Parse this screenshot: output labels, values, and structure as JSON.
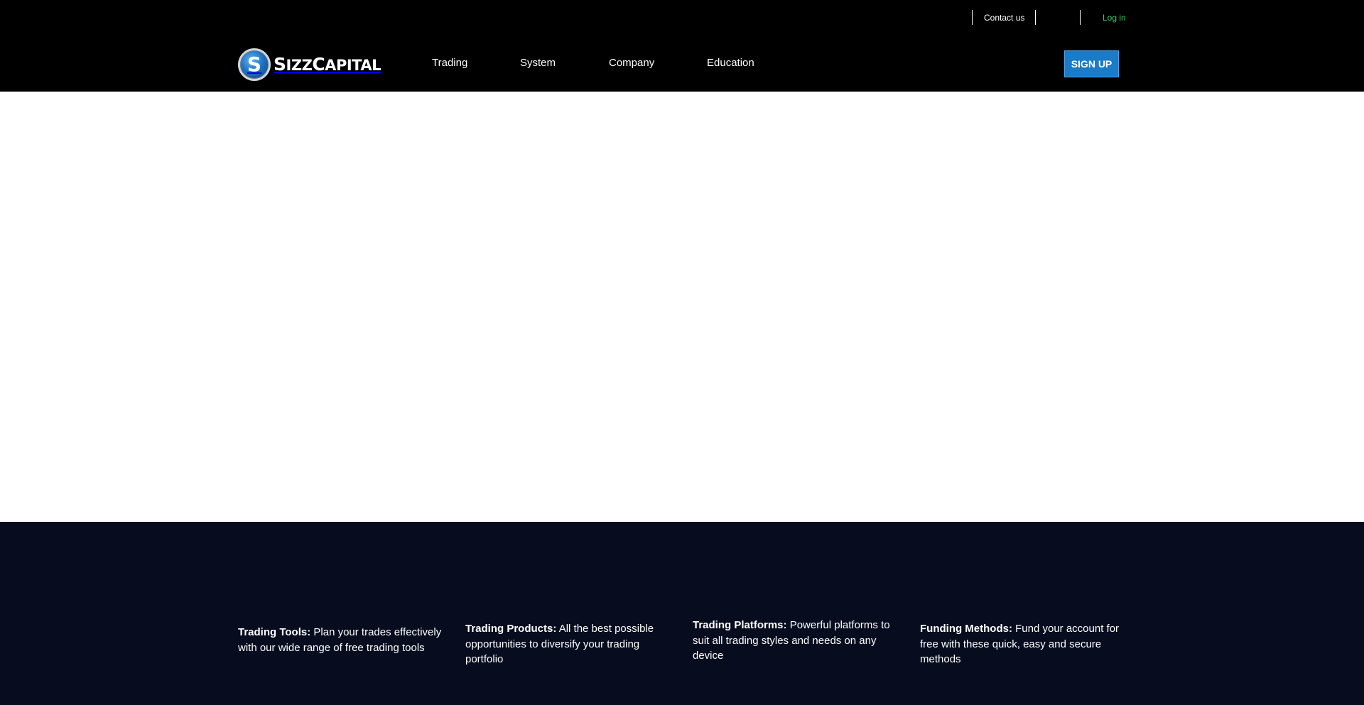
{
  "topbar": {
    "contact_label": "Contact us",
    "login_label": "Log in"
  },
  "brand": {
    "badge_letter": "S",
    "name": "SizzCapital",
    "logo_colors": {
      "badge": "#1e74c4",
      "ring": "#cfd6dc",
      "text": "#ffffff"
    }
  },
  "nav": {
    "items": [
      {
        "label": "Trading"
      },
      {
        "label": "System"
      },
      {
        "label": "Company"
      },
      {
        "label": "Education"
      }
    ]
  },
  "signup": {
    "label": "SIGN UP",
    "color": "#1a7bc8"
  },
  "features": {
    "background": "#070d1f",
    "items": [
      {
        "title": "Trading Tools:",
        "text": "Plan your trades effectively with our wide range of free trading tools"
      },
      {
        "title": "Trading Products:",
        "text": "All the best possible opportunities to diversify your trading portfolio"
      },
      {
        "title": "Trading Platforms:",
        "text": "Powerful platforms to suit all trading styles and needs on any device"
      },
      {
        "title": "Funding Methods:",
        "text": "Fund your account for free with these quick, easy and secure methods"
      }
    ]
  },
  "colors": {
    "header_bg": "#000000",
    "login_link": "#3ec46d"
  }
}
